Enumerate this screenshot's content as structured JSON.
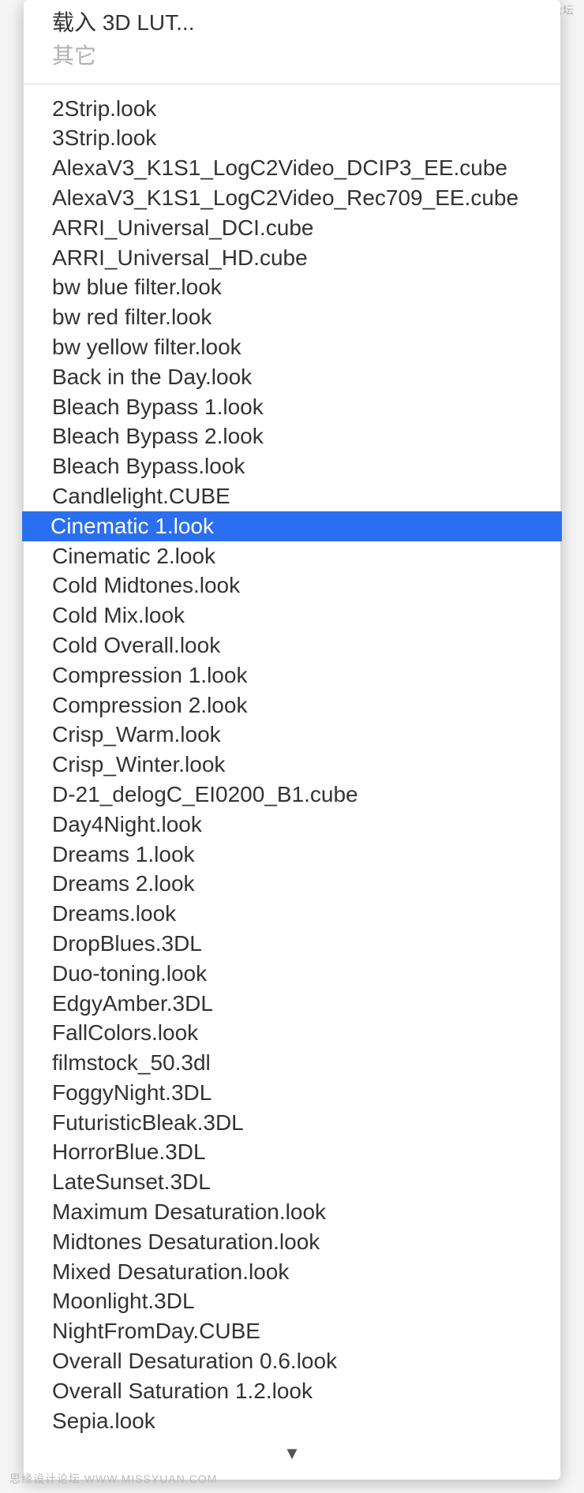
{
  "header": {
    "load_label": "载入 3D LUT...",
    "other_label": "其它"
  },
  "selected_index": 14,
  "luts": [
    "2Strip.look",
    "3Strip.look",
    "AlexaV3_K1S1_LogC2Video_DCIP3_EE.cube",
    "AlexaV3_K1S1_LogC2Video_Rec709_EE.cube",
    "ARRI_Universal_DCI.cube",
    "ARRI_Universal_HD.cube",
    "bw blue filter.look",
    "bw red filter.look",
    "bw yellow filter.look",
    "Back in the Day.look",
    "Bleach Bypass 1.look",
    "Bleach Bypass 2.look",
    "Bleach Bypass.look",
    "Candlelight.CUBE",
    "Cinematic 1.look",
    "Cinematic 2.look",
    "Cold Midtones.look",
    "Cold Mix.look",
    "Cold Overall.look",
    "Compression 1.look",
    "Compression 2.look",
    "Crisp_Warm.look",
    "Crisp_Winter.look",
    "D-21_delogC_EI0200_B1.cube",
    "Day4Night.look",
    "Dreams 1.look",
    "Dreams 2.look",
    "Dreams.look",
    "DropBlues.3DL",
    "Duo-toning.look",
    "EdgyAmber.3DL",
    "FallColors.look",
    "filmstock_50.3dl",
    "FoggyNight.3DL",
    "FuturisticBleak.3DL",
    "HorrorBlue.3DL",
    "LateSunset.3DL",
    "Maximum Desaturation.look",
    "Midtones Desaturation.look",
    "Mixed Desaturation.look",
    "Moonlight.3DL",
    "NightFromDay.CUBE",
    "Overall Desaturation 0.6.look",
    "Overall Saturation 1.2.look",
    "Sepia.look"
  ],
  "scroll_indicator": "▼",
  "watermark_top": "思缘设计论坛  PS教程论坛",
  "watermark_bottom": "思缘设计论坛 WWW.MISSYUAN.COM"
}
